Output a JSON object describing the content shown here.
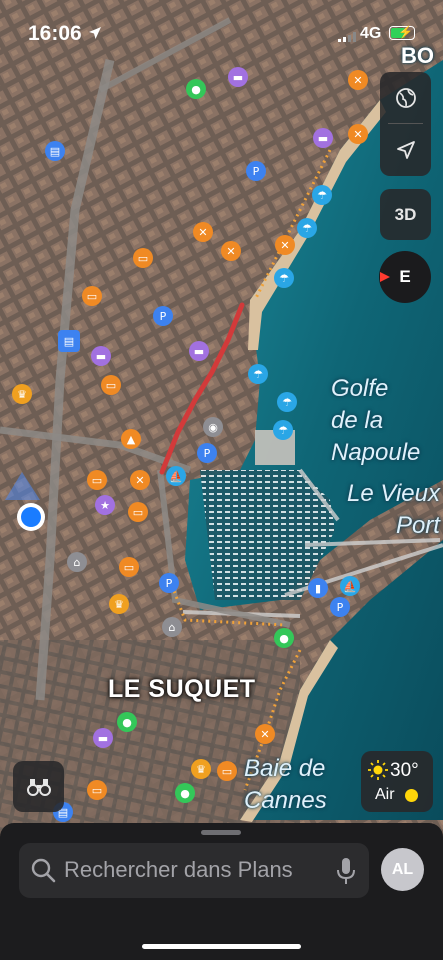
{
  "status_bar": {
    "time": "16:06",
    "network": "4G"
  },
  "map": {
    "labels": {
      "gulf": "Golfe\nde la\nNapoule",
      "port": "Le Vieux\nPort",
      "bay": "Baie de\nCannes",
      "quarter": "LE SUQUET",
      "corner": "BO"
    },
    "colors": {
      "land": "#6f5f55",
      "sea": "#0f5f6e",
      "beach": "#d9c19f",
      "route": "#d23a3a"
    }
  },
  "controls": {
    "globe": "globe-icon",
    "location": "location-arrow-icon",
    "three_d": "3D",
    "compass": "E",
    "binoculars": "binoculars-icon"
  },
  "weather": {
    "temperature": "30°",
    "air_quality": "Air"
  },
  "search": {
    "placeholder": "Rechercher dans Plans"
  },
  "profile": {
    "initials": "AL"
  }
}
